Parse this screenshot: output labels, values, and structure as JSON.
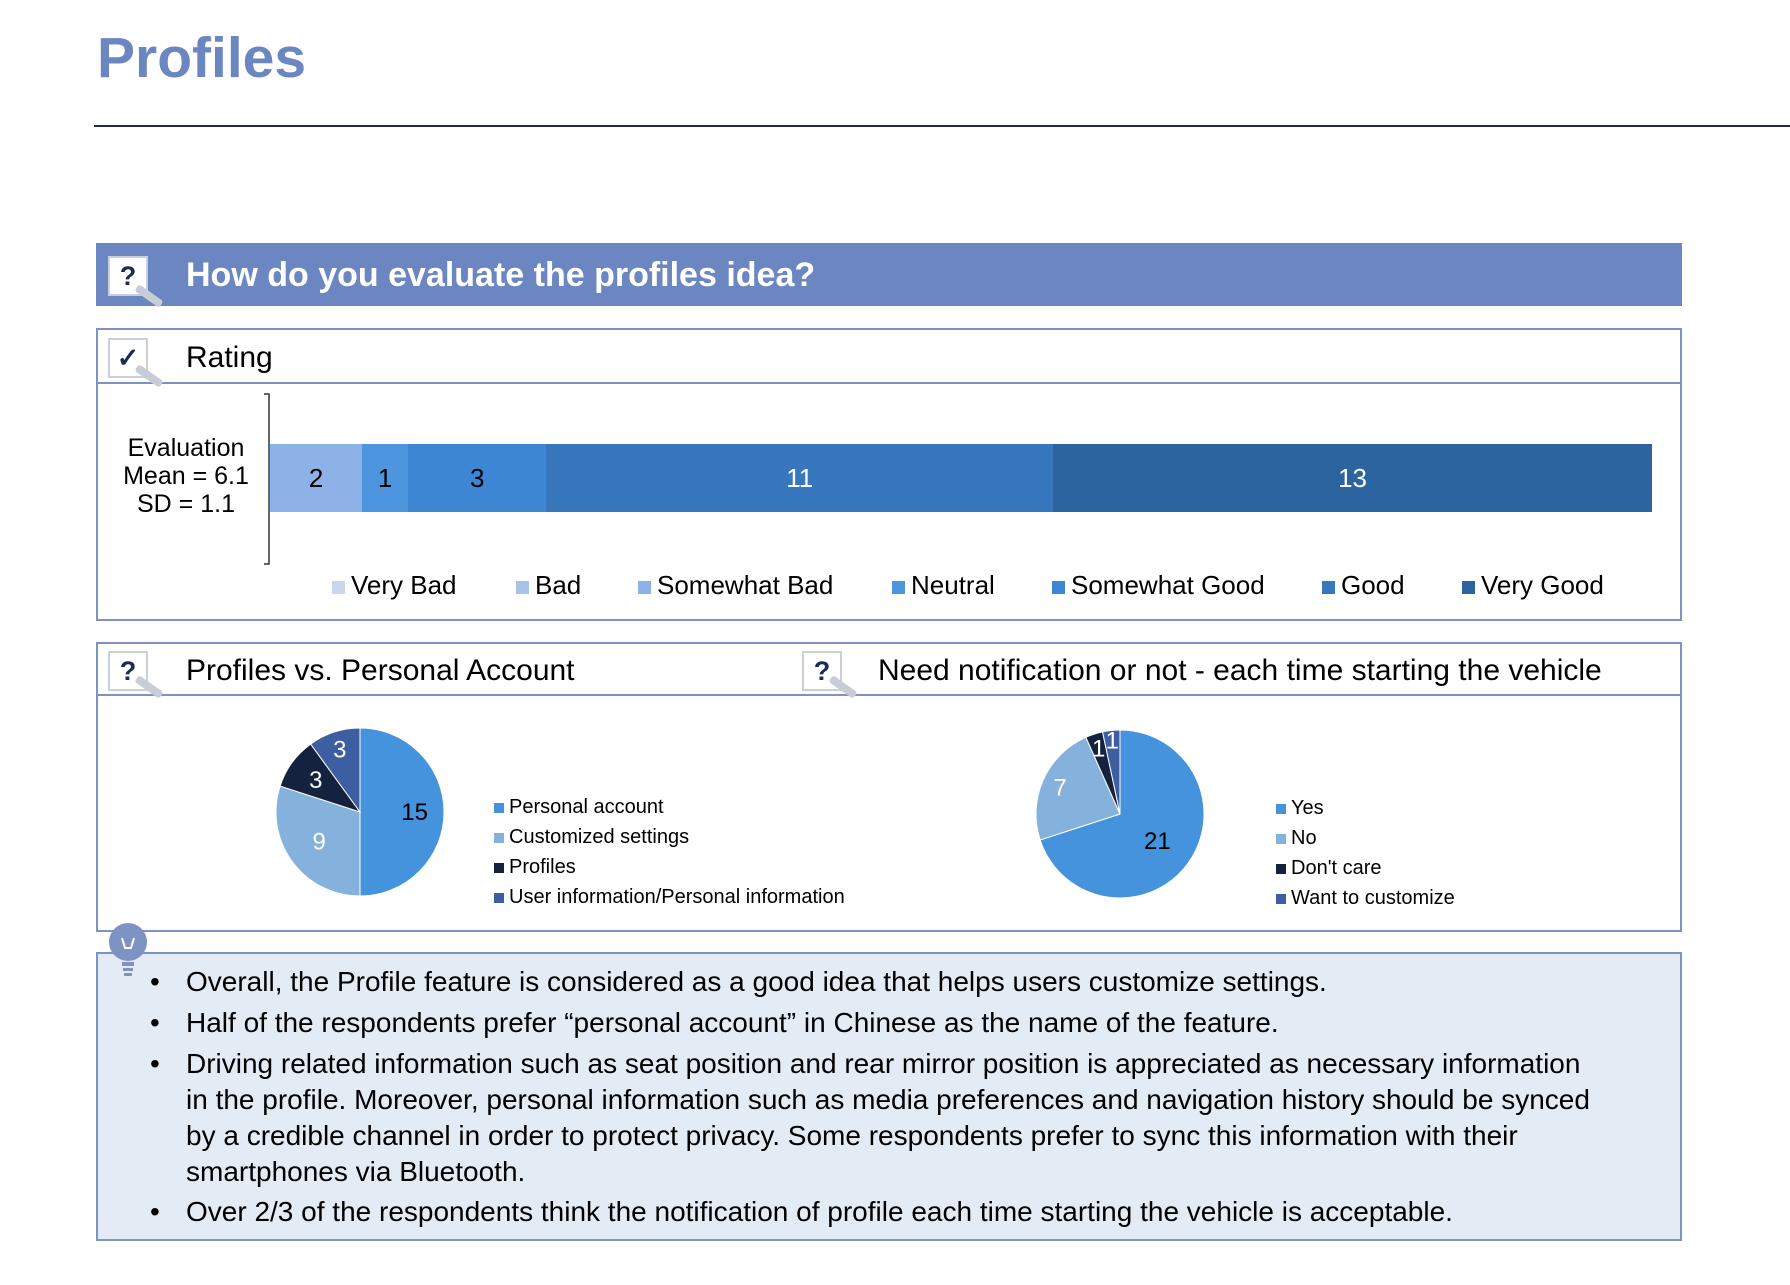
{
  "page": {
    "title": "Profiles"
  },
  "question": {
    "text": "How do you evaluate the profiles idea?"
  },
  "rating": {
    "header": "Rating",
    "stats": [
      "Evaluation",
      "Mean = 6.1",
      "SD = 1.1"
    ]
  },
  "pies": {
    "left_header": "Profiles vs. Personal Account",
    "right_header": "Need notification or not - each time starting the vehicle"
  },
  "summary": {
    "bullets": [
      "Overall, the Profile feature is considered as a good idea that helps users customize settings.",
      "Half of the respondents prefer “personal account” in Chinese as the name of the feature.",
      "Driving related information such as seat position and rear mirror position is appreciated as necessary information in the profile. Moreover, personal information such as media preferences and navigation history should be synced by a credible channel in order to protect privacy. Some respondents prefer to sync this information with their smartphones via Bluetooth.",
      "Over 2/3 of the respondents think the notification of profile each time starting the vehicle is acceptable."
    ]
  },
  "icons": {
    "question": "question-magnifier-icon",
    "check": "check-magnifier-icon",
    "lightbulb": "lightbulb-icon"
  },
  "chart_data": [
    {
      "type": "bar",
      "orientation": "horizontal-stacked",
      "categories": [
        "Evaluation"
      ],
      "series": [
        {
          "name": "Very Bad",
          "values": [
            0
          ],
          "color": "#c9d7ee"
        },
        {
          "name": "Bad",
          "values": [
            0
          ],
          "color": "#a9c2e8"
        },
        {
          "name": "Somewhat Bad",
          "values": [
            2
          ],
          "color": "#8db2e7"
        },
        {
          "name": "Neutral",
          "values": [
            1
          ],
          "color": "#4d96df"
        },
        {
          "name": "Somewhat Good",
          "values": [
            3
          ],
          "color": "#3d86d4"
        },
        {
          "name": "Good",
          "values": [
            11
          ],
          "color": "#3677bd"
        },
        {
          "name": "Very Good",
          "values": [
            13
          ],
          "color": "#2c64a0"
        }
      ],
      "legend": "bottom"
    },
    {
      "type": "pie",
      "labels": [
        "Personal account",
        "Customized settings",
        "Profiles",
        "User information/Personal information"
      ],
      "values": [
        15,
        9,
        3,
        3
      ],
      "colors": [
        "#4592dd",
        "#85b2dd",
        "#14223f",
        "#3e5ea2"
      ],
      "legend": "right"
    },
    {
      "type": "pie",
      "labels": [
        "Yes",
        "No",
        "Don't care",
        "Want to customize"
      ],
      "values": [
        21,
        7,
        1,
        1
      ],
      "colors": [
        "#4592dd",
        "#85b2dd",
        "#14223f",
        "#3e5ea2"
      ],
      "legend": "right"
    }
  ]
}
